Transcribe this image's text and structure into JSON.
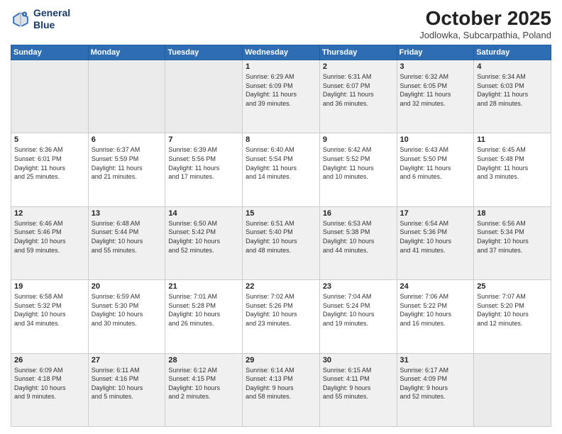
{
  "header": {
    "logo_line1": "General",
    "logo_line2": "Blue",
    "month": "October 2025",
    "location": "Jodlowka, Subcarpathia, Poland"
  },
  "weekdays": [
    "Sunday",
    "Monday",
    "Tuesday",
    "Wednesday",
    "Thursday",
    "Friday",
    "Saturday"
  ],
  "weeks": [
    [
      {
        "day": "",
        "info": ""
      },
      {
        "day": "",
        "info": ""
      },
      {
        "day": "",
        "info": ""
      },
      {
        "day": "1",
        "info": "Sunrise: 6:29 AM\nSunset: 6:09 PM\nDaylight: 11 hours\nand 39 minutes."
      },
      {
        "day": "2",
        "info": "Sunrise: 6:31 AM\nSunset: 6:07 PM\nDaylight: 11 hours\nand 36 minutes."
      },
      {
        "day": "3",
        "info": "Sunrise: 6:32 AM\nSunset: 6:05 PM\nDaylight: 11 hours\nand 32 minutes."
      },
      {
        "day": "4",
        "info": "Sunrise: 6:34 AM\nSunset: 6:03 PM\nDaylight: 11 hours\nand 28 minutes."
      }
    ],
    [
      {
        "day": "5",
        "info": "Sunrise: 6:36 AM\nSunset: 6:01 PM\nDaylight: 11 hours\nand 25 minutes."
      },
      {
        "day": "6",
        "info": "Sunrise: 6:37 AM\nSunset: 5:59 PM\nDaylight: 11 hours\nand 21 minutes."
      },
      {
        "day": "7",
        "info": "Sunrise: 6:39 AM\nSunset: 5:56 PM\nDaylight: 11 hours\nand 17 minutes."
      },
      {
        "day": "8",
        "info": "Sunrise: 6:40 AM\nSunset: 5:54 PM\nDaylight: 11 hours\nand 14 minutes."
      },
      {
        "day": "9",
        "info": "Sunrise: 6:42 AM\nSunset: 5:52 PM\nDaylight: 11 hours\nand 10 minutes."
      },
      {
        "day": "10",
        "info": "Sunrise: 6:43 AM\nSunset: 5:50 PM\nDaylight: 11 hours\nand 6 minutes."
      },
      {
        "day": "11",
        "info": "Sunrise: 6:45 AM\nSunset: 5:48 PM\nDaylight: 11 hours\nand 3 minutes."
      }
    ],
    [
      {
        "day": "12",
        "info": "Sunrise: 6:46 AM\nSunset: 5:46 PM\nDaylight: 10 hours\nand 59 minutes."
      },
      {
        "day": "13",
        "info": "Sunrise: 6:48 AM\nSunset: 5:44 PM\nDaylight: 10 hours\nand 55 minutes."
      },
      {
        "day": "14",
        "info": "Sunrise: 6:50 AM\nSunset: 5:42 PM\nDaylight: 10 hours\nand 52 minutes."
      },
      {
        "day": "15",
        "info": "Sunrise: 6:51 AM\nSunset: 5:40 PM\nDaylight: 10 hours\nand 48 minutes."
      },
      {
        "day": "16",
        "info": "Sunrise: 6:53 AM\nSunset: 5:38 PM\nDaylight: 10 hours\nand 44 minutes."
      },
      {
        "day": "17",
        "info": "Sunrise: 6:54 AM\nSunset: 5:36 PM\nDaylight: 10 hours\nand 41 minutes."
      },
      {
        "day": "18",
        "info": "Sunrise: 6:56 AM\nSunset: 5:34 PM\nDaylight: 10 hours\nand 37 minutes."
      }
    ],
    [
      {
        "day": "19",
        "info": "Sunrise: 6:58 AM\nSunset: 5:32 PM\nDaylight: 10 hours\nand 34 minutes."
      },
      {
        "day": "20",
        "info": "Sunrise: 6:59 AM\nSunset: 5:30 PM\nDaylight: 10 hours\nand 30 minutes."
      },
      {
        "day": "21",
        "info": "Sunrise: 7:01 AM\nSunset: 5:28 PM\nDaylight: 10 hours\nand 26 minutes."
      },
      {
        "day": "22",
        "info": "Sunrise: 7:02 AM\nSunset: 5:26 PM\nDaylight: 10 hours\nand 23 minutes."
      },
      {
        "day": "23",
        "info": "Sunrise: 7:04 AM\nSunset: 5:24 PM\nDaylight: 10 hours\nand 19 minutes."
      },
      {
        "day": "24",
        "info": "Sunrise: 7:06 AM\nSunset: 5:22 PM\nDaylight: 10 hours\nand 16 minutes."
      },
      {
        "day": "25",
        "info": "Sunrise: 7:07 AM\nSunset: 5:20 PM\nDaylight: 10 hours\nand 12 minutes."
      }
    ],
    [
      {
        "day": "26",
        "info": "Sunrise: 6:09 AM\nSunset: 4:18 PM\nDaylight: 10 hours\nand 9 minutes."
      },
      {
        "day": "27",
        "info": "Sunrise: 6:11 AM\nSunset: 4:16 PM\nDaylight: 10 hours\nand 5 minutes."
      },
      {
        "day": "28",
        "info": "Sunrise: 6:12 AM\nSunset: 4:15 PM\nDaylight: 10 hours\nand 2 minutes."
      },
      {
        "day": "29",
        "info": "Sunrise: 6:14 AM\nSunset: 4:13 PM\nDaylight: 9 hours\nand 58 minutes."
      },
      {
        "day": "30",
        "info": "Sunrise: 6:15 AM\nSunset: 4:11 PM\nDaylight: 9 hours\nand 55 minutes."
      },
      {
        "day": "31",
        "info": "Sunrise: 6:17 AM\nSunset: 4:09 PM\nDaylight: 9 hours\nand 52 minutes."
      },
      {
        "day": "",
        "info": ""
      }
    ]
  ]
}
